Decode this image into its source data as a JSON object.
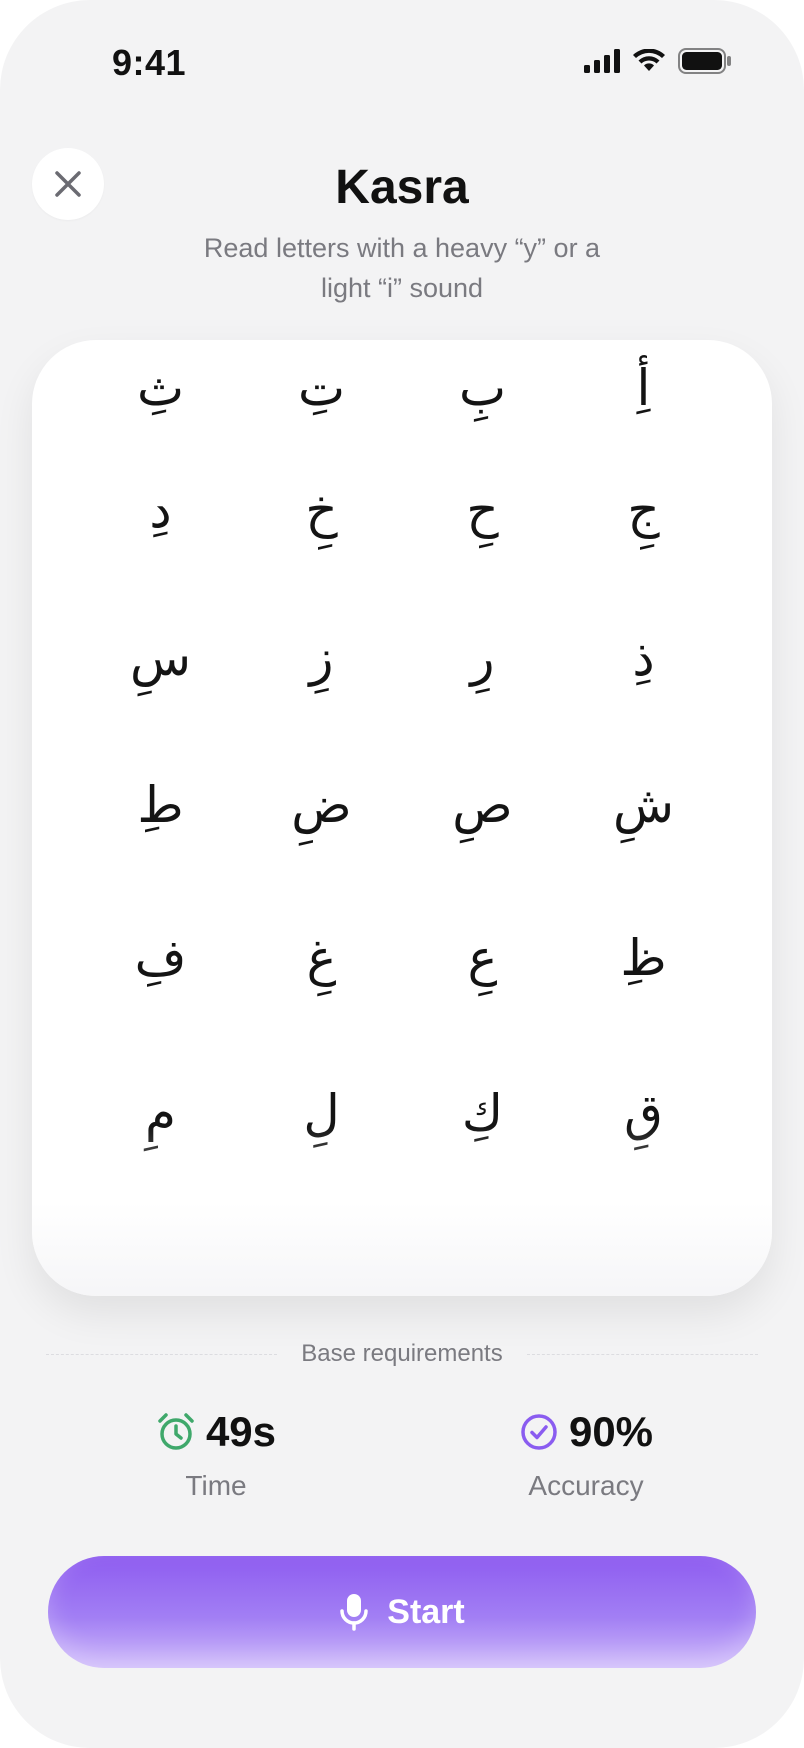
{
  "status_bar": {
    "time": "9:41"
  },
  "header": {
    "title": "Kasra",
    "subtitle": "Read letters with a heavy “y” or a light “i” sound"
  },
  "letters": [
    "أِ",
    "بِ",
    "تِ",
    "ثِ",
    "جِ",
    "حِ",
    "خِ",
    "دِ",
    "ذِ",
    "رِ",
    "زِ",
    "سِ",
    "شِ",
    "صِ",
    "ضِ",
    "طِ",
    "ظِ",
    "عِ",
    "غِ",
    "فِ",
    "قِ",
    "كِ",
    "لِ",
    "مِ"
  ],
  "requirements": {
    "label": "Base requirements",
    "time": {
      "value": "49s",
      "label": "Time",
      "icon": "alarm-clock-icon",
      "color": "#3fa86b"
    },
    "accuracy": {
      "value": "90%",
      "label": "Accuracy",
      "icon": "check-circle-icon",
      "color": "#8a5cf0"
    }
  },
  "start_button": {
    "label": "Start",
    "icon": "microphone-icon"
  },
  "colors": {
    "accent": "#8e5cf0",
    "background": "#f3f3f4"
  }
}
